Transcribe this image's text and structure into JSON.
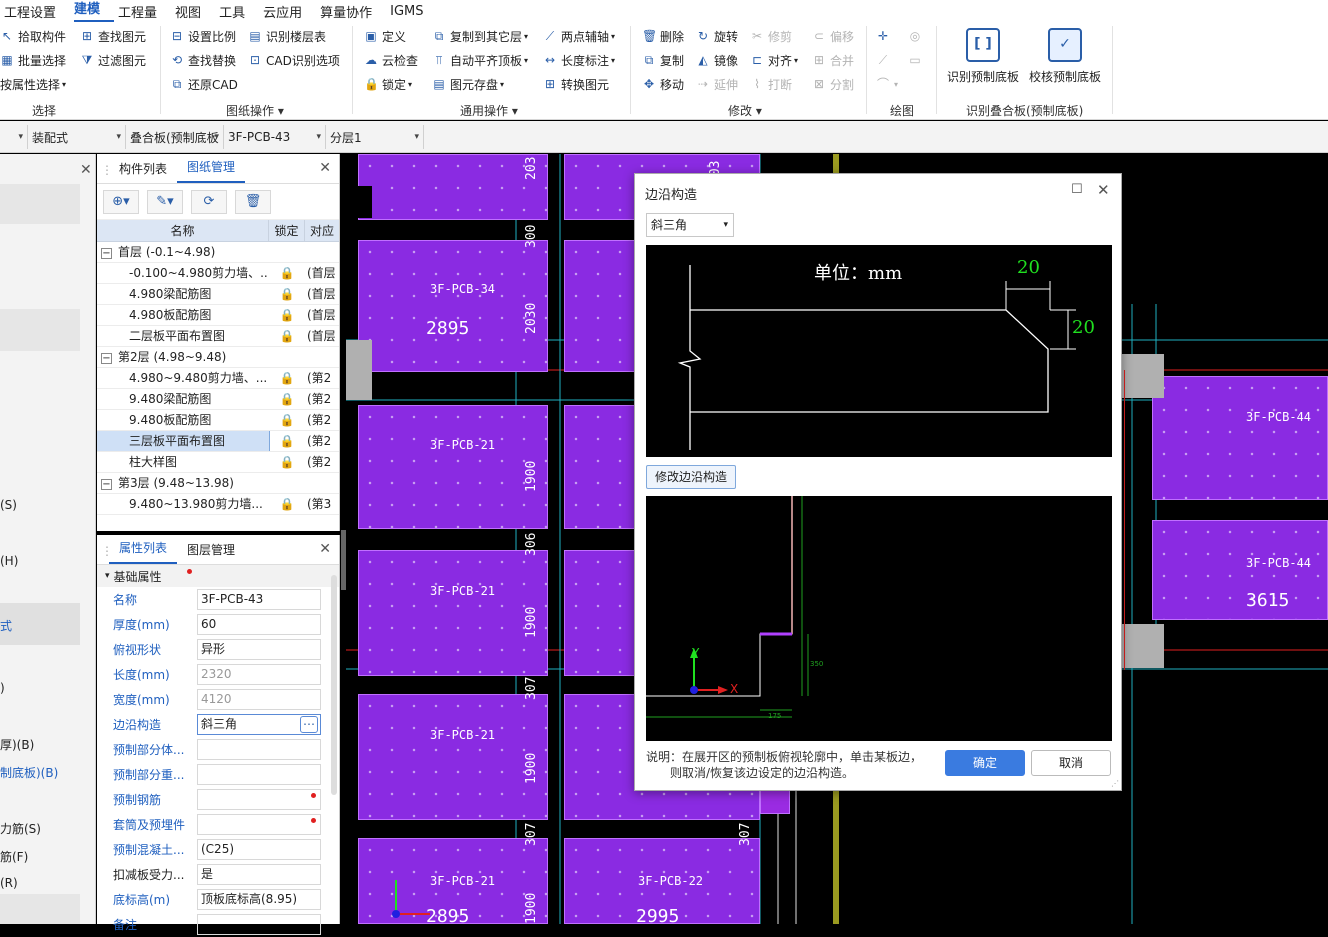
{
  "menu": [
    "工程设置",
    "建模",
    "工程量",
    "视图",
    "工具",
    "云应用",
    "算量协作",
    "IGMS"
  ],
  "menu_active": "建模",
  "ribbon": {
    "select": {
      "items": [
        "拾取构件",
        "批量选择",
        "按属性选择"
      ],
      "items2": [
        "查找图元",
        "过滤图元"
      ],
      "label": "选择"
    },
    "drawing_ops": {
      "col1": [
        "设置比例",
        "查找替换",
        "还原CAD"
      ],
      "col2": [
        "识别楼层表",
        "CAD识别选项"
      ],
      "label": "图纸操作"
    },
    "general_ops": {
      "col1": [
        "定义",
        "云检查",
        "锁定"
      ],
      "col2": [
        "复制到其它层",
        "自动平齐顶板",
        "图元存盘"
      ],
      "col3": [
        "两点辅轴",
        "长度标注",
        "转换图元"
      ],
      "label": "通用操作"
    },
    "modify": {
      "col1": [
        "删除",
        "复制",
        "移动"
      ],
      "col2": [
        "旋转",
        "镜像",
        "延伸"
      ],
      "col3": [
        "修剪",
        "对齐",
        "打断"
      ],
      "col4": [
        "偏移",
        "合并",
        "分割"
      ],
      "label": "修改"
    },
    "draw": {
      "label": "绘图"
    },
    "laminated": {
      "btn1": "识别预制底板",
      "btn2": "校核预制底板",
      "label": "识别叠合板(预制底板)"
    }
  },
  "selectors": [
    "装配式",
    "叠合板(预制底板",
    "3F-PCB-43",
    "分层1"
  ],
  "leftstrip": [
    "(S)",
    "(H)",
    "式",
    ")",
    "厚)(B)",
    "制底板)(B)",
    "力筋(S)",
    "筋(F)",
    "(R)"
  ],
  "panel1": {
    "tabs": [
      "构件列表",
      "图纸管理"
    ],
    "active_tab": "图纸管理",
    "headers": [
      "名称",
      "锁定",
      "对应"
    ],
    "rows": [
      {
        "type": "group",
        "name": "首层 (-0.1~4.98)"
      },
      {
        "type": "item",
        "name": "-0.100~4.980剪力墙、...",
        "lock": "🔒",
        "floor": "(首层"
      },
      {
        "type": "item",
        "name": "4.980梁配筋图",
        "lock": "🔒",
        "floor": "(首层"
      },
      {
        "type": "item",
        "name": "4.980板配筋图",
        "lock": "🔒",
        "floor": "(首层"
      },
      {
        "type": "item",
        "name": "二层板平面布置图",
        "lock": "🔒",
        "floor": "(首层"
      },
      {
        "type": "group",
        "name": "第2层 (4.98~9.48)"
      },
      {
        "type": "item",
        "name": "4.980~9.480剪力墙、...",
        "lock": "🔒",
        "floor": "(第2"
      },
      {
        "type": "item",
        "name": "9.480梁配筋图",
        "lock": "🔒",
        "floor": "(第2"
      },
      {
        "type": "item",
        "name": "9.480板配筋图",
        "lock": "🔒",
        "floor": "(第2"
      },
      {
        "type": "item",
        "name": "三层板平面布置图",
        "lock": "🔒",
        "floor": "(第2",
        "selected": true
      },
      {
        "type": "item",
        "name": "柱大样图",
        "lock": "🔒",
        "floor": "(第2"
      },
      {
        "type": "group",
        "name": "第3层 (9.48~13.98)"
      },
      {
        "type": "item",
        "name": "9.480~13.980剪力墙...",
        "lock": "🔒",
        "floor": "(第3"
      }
    ]
  },
  "panel2": {
    "tabs": [
      "属性列表",
      "图层管理"
    ],
    "section": "基础属性",
    "props": [
      {
        "k": "名称",
        "v": "3F-PCB-43"
      },
      {
        "k": "厚度(mm)",
        "v": "60"
      },
      {
        "k": "俯视形状",
        "v": "异形"
      },
      {
        "k": "长度(mm)",
        "v": "2320",
        "gray": true
      },
      {
        "k": "宽度(mm)",
        "v": "4120",
        "gray": true
      },
      {
        "k": "边沿构造",
        "v": "斜三角",
        "edit": true
      },
      {
        "k": "预制部分体...",
        "v": ""
      },
      {
        "k": "预制部分重...",
        "v": ""
      },
      {
        "k": "预制钢筋",
        "v": "",
        "dot": true
      },
      {
        "k": "套筒及预埋件",
        "v": "",
        "dot": true
      },
      {
        "k": "预制混凝土...",
        "v": "(C25)"
      },
      {
        "k": "扣减板受力...",
        "v": "是",
        "plain": true
      },
      {
        "k": "底标高(m)",
        "v": "顶板底标高(8.95)"
      },
      {
        "k": "备注",
        "v": ""
      }
    ]
  },
  "canvas": {
    "slab_labels": [
      "3F-PCB-34",
      "3F-PCB-21",
      "3F-PCB-21",
      "3F-PCB-21",
      "3F-PCB-21",
      "3F-PCB-22",
      "3F-PCB-44",
      "3F-PCB-44"
    ],
    "numbers": [
      "2895",
      "3615",
      "2995",
      "2895"
    ],
    "vertical": [
      "203",
      "300",
      "2030",
      "1900",
      "306",
      "1900",
      "307",
      "1900",
      "307",
      "1900",
      "203",
      "307"
    ]
  },
  "dialog": {
    "title": "边沿构造",
    "select_value": "斜三角",
    "unit_text": "单位：mm",
    "dim1": "20",
    "dim2": "20",
    "modify_btn": "修改边沿构造",
    "small_dims": [
      "175",
      "350"
    ],
    "axis_x": "X",
    "axis_y": "Y",
    "note_line1": "说明：在展开区的预制板俯视轮廓中，单击某板边，",
    "note_line2": "则取消/恢复该边设定的边沿构造。",
    "ok": "确定",
    "cancel": "取消"
  },
  "colors": {
    "accent": "#1f5fbf",
    "slab": "#8a2be2",
    "primary_btn": "#3a7be0"
  }
}
